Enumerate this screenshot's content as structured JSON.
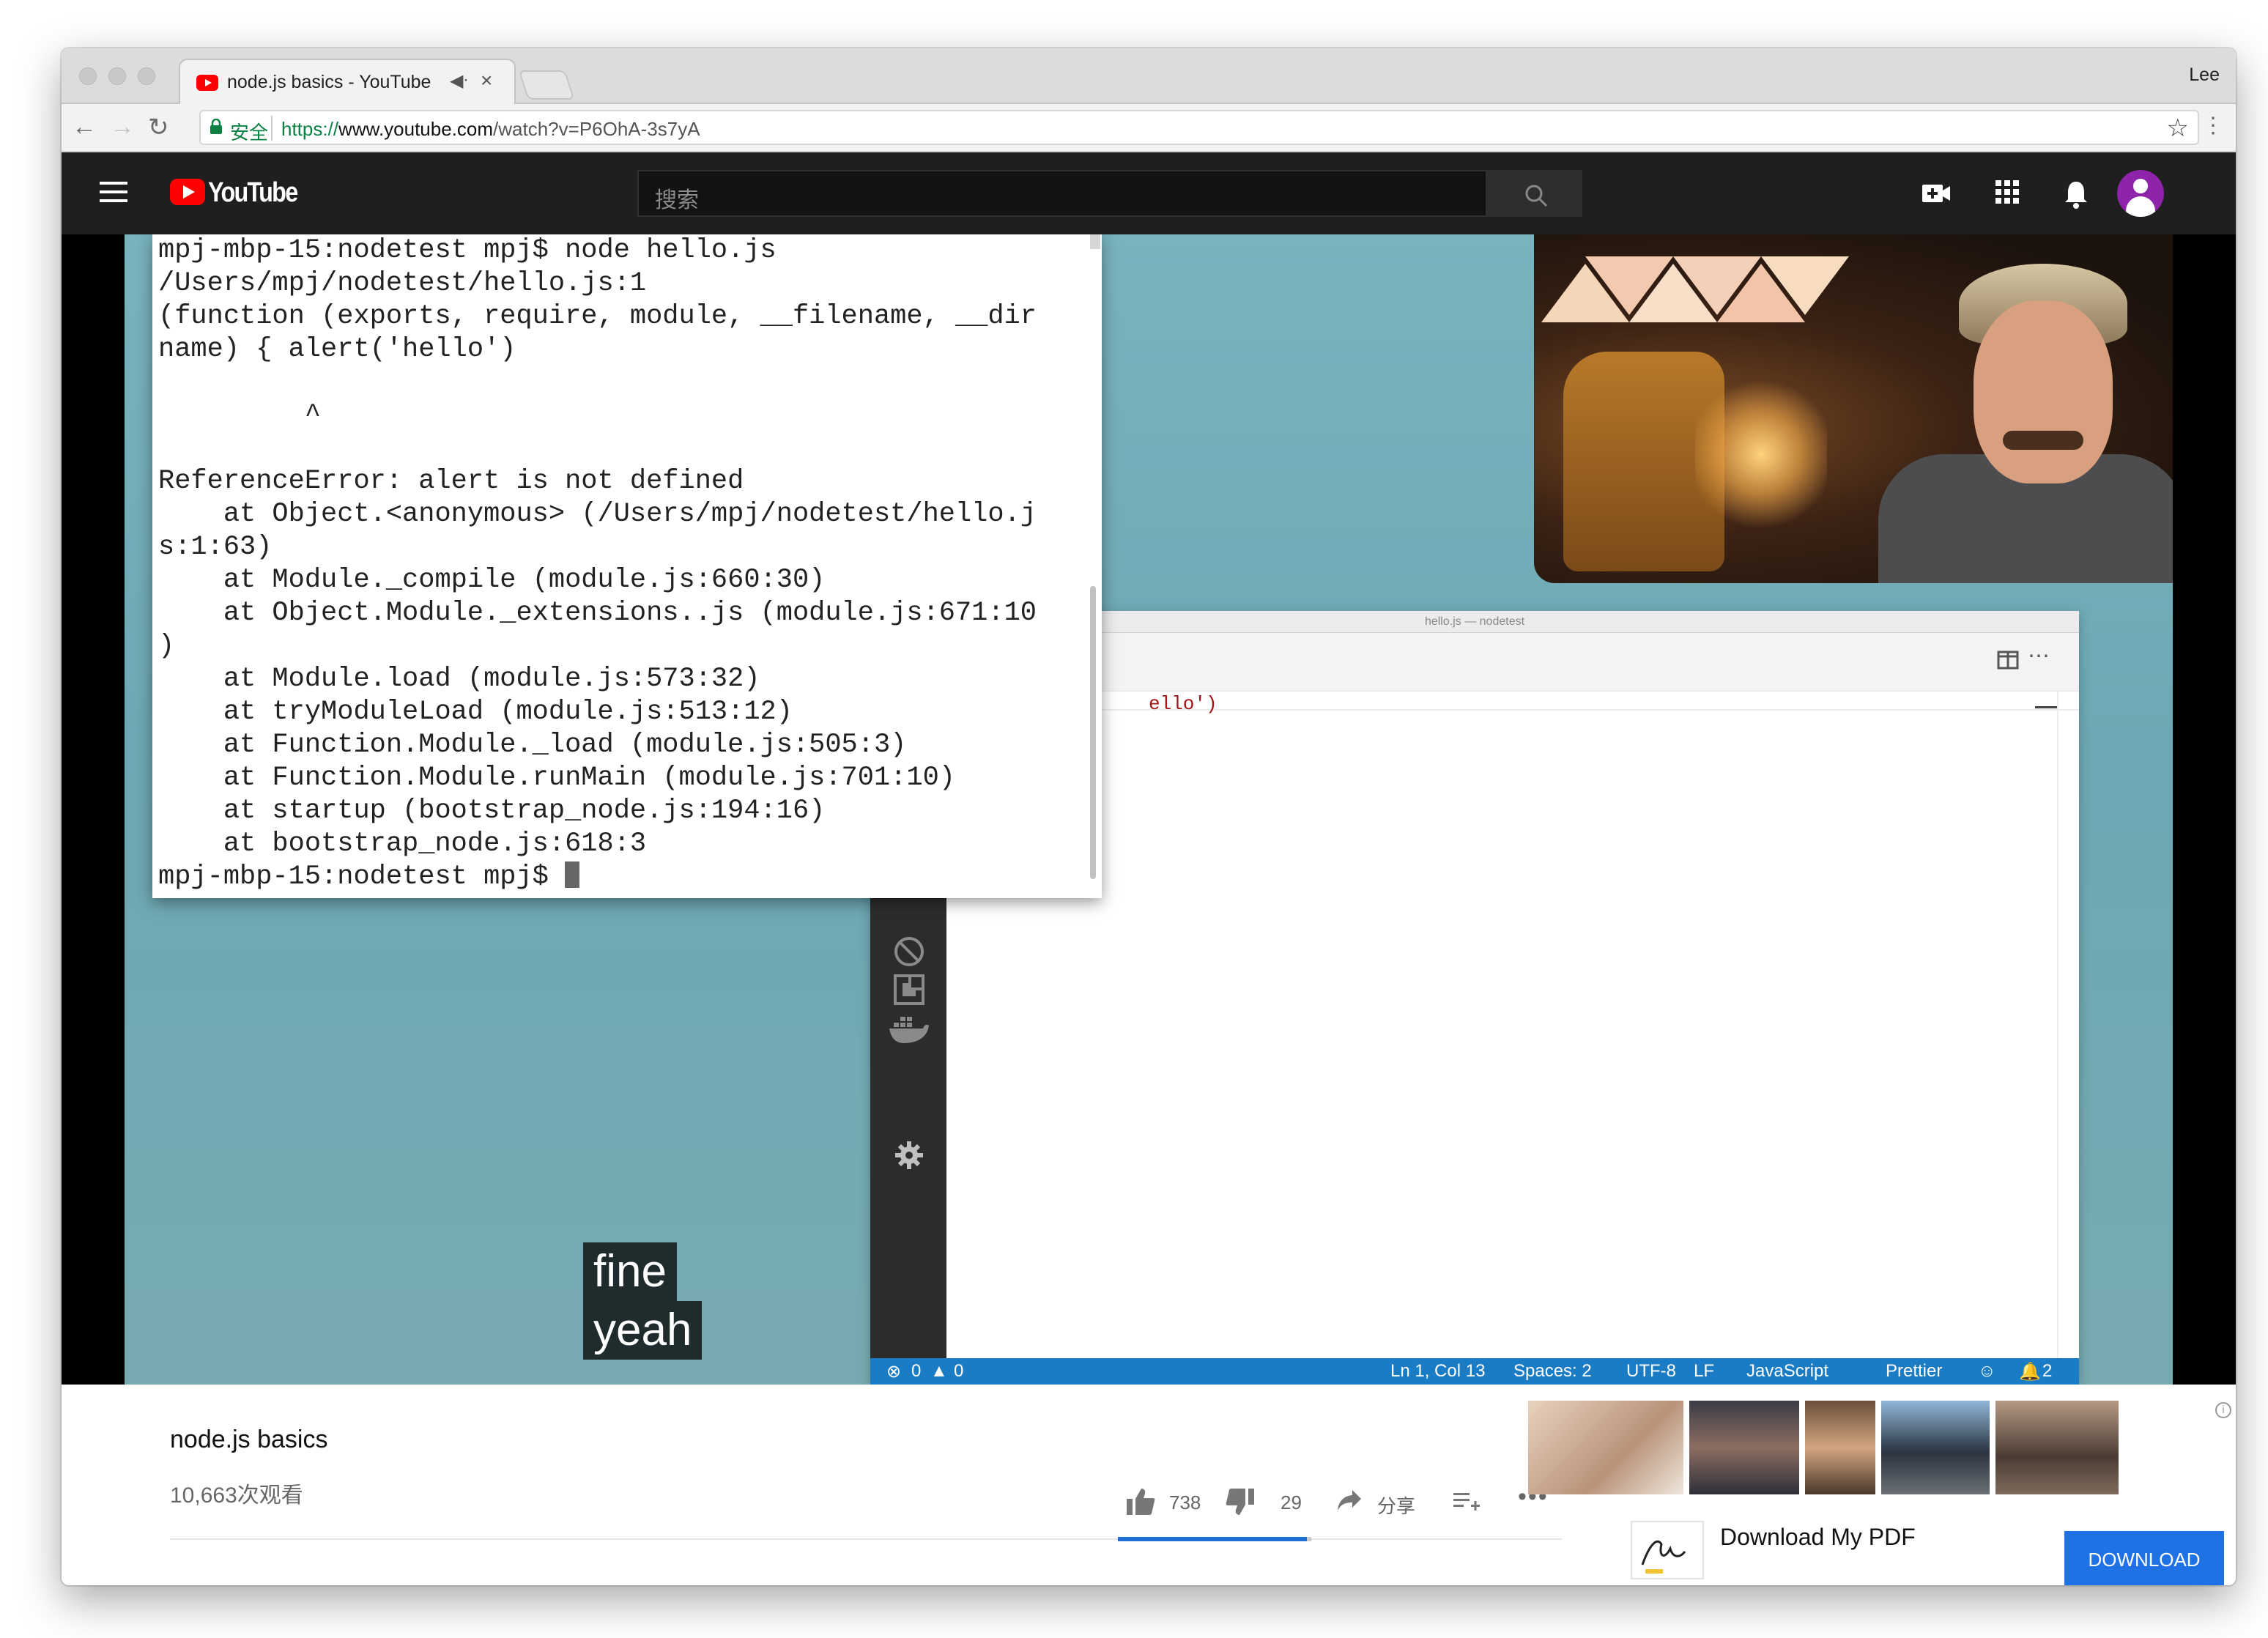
{
  "browser": {
    "tab_title": "node.js basics - YouTube",
    "tab_audio_icon": "speaker-muted-icon",
    "tab_close": "×",
    "profile_name": "Lee",
    "secure_label": "安全",
    "url_scheme": "https://",
    "url_domain": "www.youtube.com",
    "url_path": "/watch?v=P6OhA-3s7yA"
  },
  "youtube": {
    "logo_text": "YouTube",
    "search_placeholder": "搜索",
    "icons": [
      "upload-video-icon",
      "apps-grid-icon",
      "notifications-bell-icon",
      "account-avatar-icon"
    ]
  },
  "terminal": {
    "lines": [
      "mpj-mbp-15:nodetest mpj$ node hello.js",
      "/Users/mpj/nodetest/hello.js:1",
      "(function (exports, require, module, __filename, __dir",
      "name) { alert('hello')",
      "",
      "         ^",
      "",
      "ReferenceError: alert is not defined",
      "    at Object.<anonymous> (/Users/mpj/nodetest/hello.j",
      "s:1:63)",
      "    at Module._compile (module.js:660:30)",
      "    at Object.Module._extensions..js (module.js:671:10",
      ")",
      "    at Module.load (module.js:573:32)",
      "    at tryModuleLoad (module.js:513:12)",
      "    at Function.Module._load (module.js:505:3)",
      "    at Function.Module.runMain (module.js:701:10)",
      "    at startup (bootstrap_node.js:194:16)",
      "    at bootstrap_node.js:618:3",
      "mpj-mbp-15:nodetest mpj$ "
    ]
  },
  "vscode": {
    "window_title": "hello.js — nodetest",
    "code_fragment": "ello')",
    "status": {
      "errors": "0",
      "warnings": "0",
      "position": "Ln 1, Col 13",
      "spaces": "Spaces: 2",
      "encoding": "UTF-8",
      "eol": "LF",
      "language": "JavaScript",
      "formatter": "Prettier",
      "notifications": "2"
    }
  },
  "captions": [
    "fine",
    "yeah"
  ],
  "video": {
    "title": "node.js basics",
    "views": "10,663次观看",
    "likes": "738",
    "dislikes": "29",
    "share_label": "分享",
    "like_ratio": 0.962
  },
  "ad": {
    "text": "Download My PDF",
    "button": "DOWNLOAD",
    "info": "i"
  }
}
